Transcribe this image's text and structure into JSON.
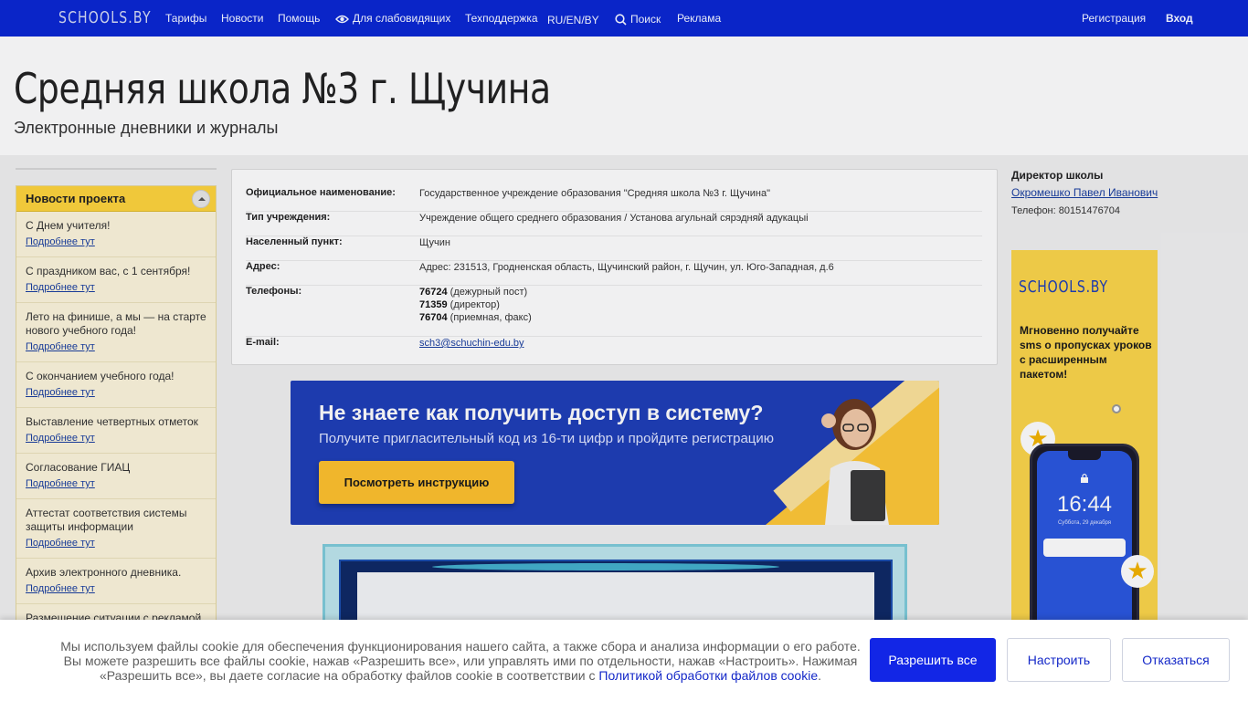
{
  "topnav": {
    "logo": "SCHOOLS.BY",
    "items": [
      "Тарифы",
      "Новости",
      "Помощь",
      "Для слабовидящих",
      "Техподдержка",
      "RU/EN/BY",
      "Поиск",
      "Реклама"
    ],
    "register": "Регистрация",
    "login": "Вход"
  },
  "header": {
    "title": "Средняя школа №3 г. Щучина",
    "subtitle": "Электронные дневники и журналы"
  },
  "sidebar": {
    "title": "Новости проекта",
    "more_label": "Подробнее тут",
    "items": [
      "С Днем учителя!",
      "С праздником вас, с 1 сентября!",
      "Лето на финише, а мы — на старте нового учебного года!",
      "С окончанием учебного года!",
      "Выставление четвертных отметок",
      "Согласование ГИАЦ",
      "Аттестат соответствия системы защиты информации",
      "Архив электронного дневника.",
      "Размещение ситуации с рекламой"
    ]
  },
  "info": {
    "official_name": {
      "label": "Официальное наименование:",
      "value": "Государственное учреждение образования \"Средняя школа №3 г. Щучина\""
    },
    "type": {
      "label": "Тип учреждения:",
      "value": "Учреждение общего среднего образования / Установа агульнай сярэдняй адукацыі"
    },
    "locality": {
      "label": "Населенный пункт:",
      "value": "Щучин"
    },
    "address": {
      "label": "Адрес:",
      "value": "Адрес: 231513, Гродненская область, Щучинский район, г. Щучин, ул. Юго-Западная, д.6"
    },
    "phones": {
      "label": "Телефоны:",
      "list": [
        {
          "number": "76724",
          "note": "(дежурный пост)"
        },
        {
          "number": "71359",
          "note": "(директор)"
        },
        {
          "number": "76704",
          "note": "(приемная, факс)"
        }
      ]
    },
    "email": {
      "label": "E-mail:",
      "value": "sch3@schuchin-edu.by"
    }
  },
  "director": {
    "role": "Директор школы",
    "name": "Окромешко Павел Иванович",
    "phone": "Телефон: 80151476704"
  },
  "promo": {
    "headline": "Не знаете как получить доступ в систему?",
    "sub": "Получите пригласительный код из 16-ти цифр и пройдите регистрацию",
    "button": "Посмотреть инструкцию"
  },
  "ad": {
    "logo": "SCHOOLS.BY",
    "text": "Мгновенно получайте sms о пропусках уроков с расширенным пакетом!",
    "clock": "16:44",
    "date": "Суббота, 29 декабря"
  },
  "cookie": {
    "text_before": "Мы используем файлы cookie для обеспечения функционирования нашего сайта, а также сбора и анализа информации о его работе. Вы можете разрешить все файлы cookie, нажав «Разрешить все», или управлять ими по отдельности, нажав «Настроить». Нажимая «Разрешить все», вы даете согласие на обработку файлов cookie в соответствии с ",
    "link": "Политикой обработки файлов cookie",
    "text_after": ".",
    "accept": "Разрешить все",
    "settings": "Настроить",
    "reject": "Отказаться"
  },
  "colors": {
    "topbar": "#0a25c8",
    "accent_yellow": "#ffd53d",
    "banner_blue": "#1f3fb8",
    "cookie_button": "#1226e6"
  },
  "icons": [
    "eye-icon",
    "search-icon",
    "collapse-arrow-icon",
    "star-icon",
    "lock-icon"
  ]
}
